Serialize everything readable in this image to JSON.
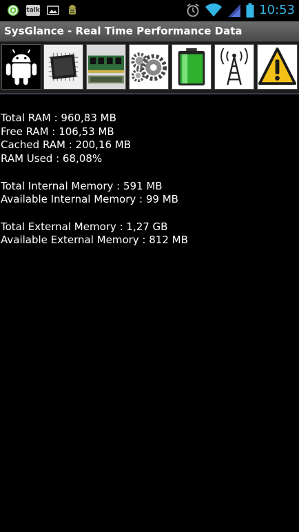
{
  "status_bar": {
    "notification_icons": [
      "email-icon",
      "talk-icon",
      "gallery-icon",
      "android-debug-icon"
    ],
    "talk_label": "talk",
    "system_icons": [
      "alarm-icon",
      "wifi-icon",
      "signal-icon",
      "battery-icon"
    ],
    "time": "10:53",
    "accent_color": "#33b5e5"
  },
  "app": {
    "title": "SysGlance - Real Time Performance Data"
  },
  "toolbar": {
    "buttons": [
      {
        "name": "android-icon",
        "selected": false
      },
      {
        "name": "cpu-icon",
        "selected": false
      },
      {
        "name": "ram-module-icon",
        "selected": true
      },
      {
        "name": "gears-icon",
        "selected": false
      },
      {
        "name": "battery-icon",
        "selected": false
      },
      {
        "name": "antenna-icon",
        "selected": false
      },
      {
        "name": "warning-icon",
        "selected": false
      }
    ]
  },
  "memory": {
    "ram": [
      "Total RAM : 960,83 MB",
      "Free RAM : 106,53 MB",
      "Cached RAM : 200,16 MB",
      "RAM Used : 68,08%"
    ],
    "internal": [
      "Total Internal Memory : 591 MB",
      "Available Internal Memory : 99 MB"
    ],
    "external": [
      "Total External Memory : 1,27 GB",
      "Available External Memory : 812 MB"
    ]
  }
}
